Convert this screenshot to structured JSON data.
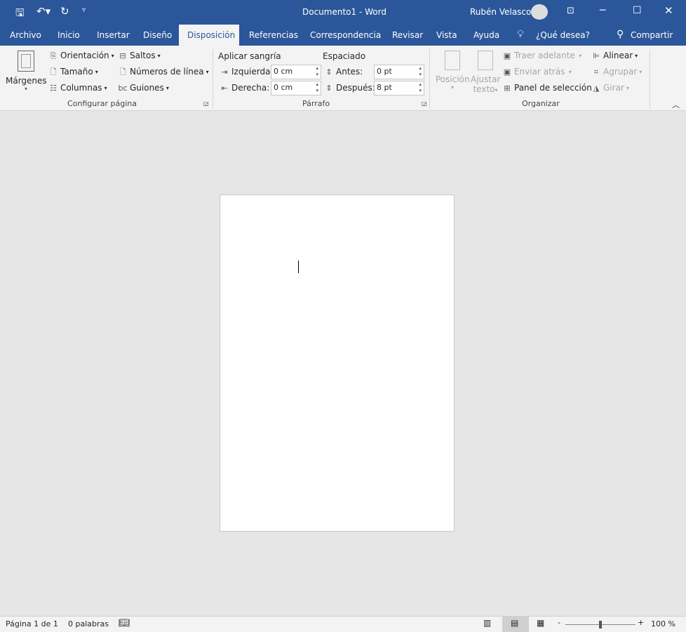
{
  "title": {
    "doc": "Documento1  -  Word",
    "user": "Rubén Velasco"
  },
  "tabs": [
    "Archivo",
    "Inicio",
    "Insertar",
    "Diseño",
    "Disposición",
    "Referencias",
    "Correspondencia",
    "Revisar",
    "Vista",
    "Ayuda"
  ],
  "tell_me": "¿Qué desea?",
  "share": "Compartir",
  "page_setup": {
    "margins": "Márgenes",
    "orientation": "Orientación",
    "size": "Tamaño",
    "columns": "Columnas",
    "breaks": "Saltos",
    "line_numbers": "Números de línea",
    "hyphenation": "Guiones",
    "group": "Configurar página"
  },
  "paragraph": {
    "indent_title": "Aplicar sangría",
    "left_label": "Izquierda:",
    "left_value": "0 cm",
    "right_label": "Derecha:",
    "right_value": "0 cm",
    "spacing_title": "Espaciado",
    "before_label": "Antes:",
    "before_value": "0 pt",
    "after_label": "Después:",
    "after_value": "8 pt",
    "group": "Párrafo"
  },
  "arrange": {
    "position": "Posición",
    "wrap1": "Ajustar",
    "wrap2": "texto",
    "bring_forward": "Traer adelante",
    "send_backward": "Enviar atrás",
    "selection_pane": "Panel de selección",
    "align": "Alinear",
    "group_btn": "Agrupar",
    "rotate": "Girar",
    "group": "Organizar"
  },
  "status": {
    "page": "Página 1 de 1",
    "words": "0 palabras",
    "zoom": "100 %",
    "zoom_fraction": 0.5
  }
}
